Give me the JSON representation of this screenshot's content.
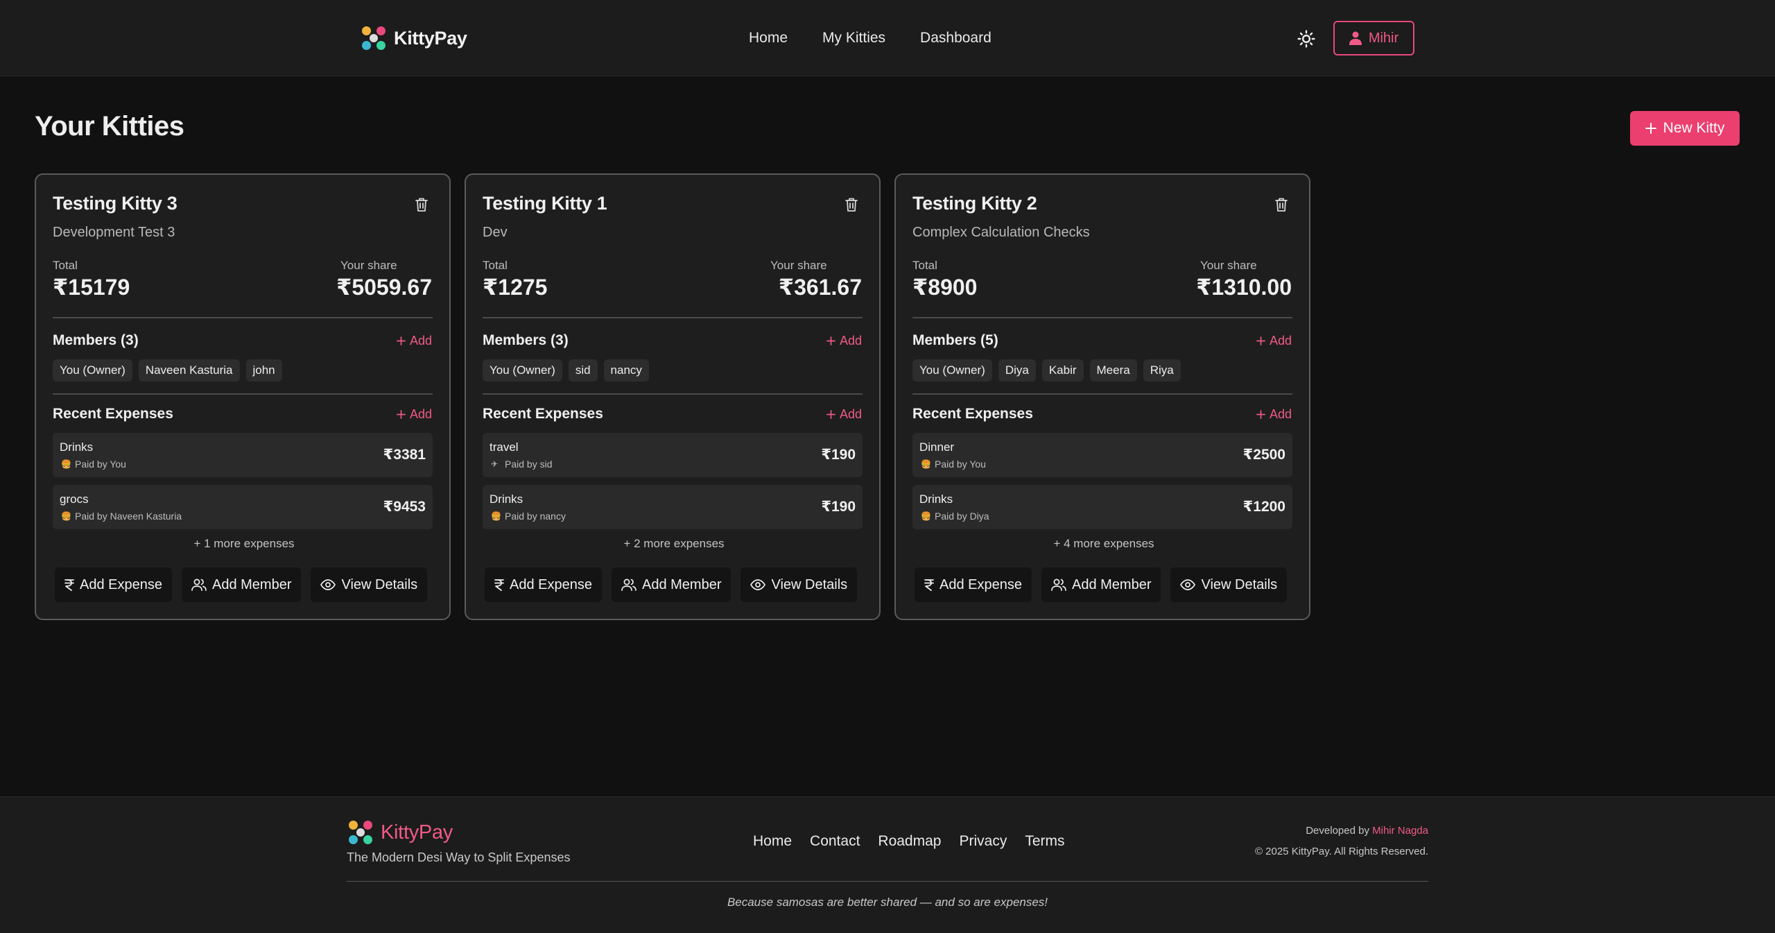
{
  "nav": {
    "brand": "KittyPay",
    "links": [
      "Home",
      "My Kitties",
      "Dashboard"
    ],
    "user_label": "Mihir"
  },
  "page": {
    "title": "Your Kitties",
    "new_kitty_label": "New Kitty"
  },
  "labels": {
    "total": "Total",
    "your_share": "Your share",
    "recent_expenses": "Recent Expenses",
    "add": "Add",
    "add_expense": "Add Expense",
    "add_member": "Add Member",
    "view_details": "View Details"
  },
  "kitties": [
    {
      "name": "Testing Kitty 3",
      "description": "Development Test 3",
      "total": "₹15179",
      "share": "₹5059.67",
      "members_title": "Members (3)",
      "members": [
        "You (Owner)",
        "Naveen Kasturia",
        "john"
      ],
      "expenses": [
        {
          "name": "Drinks",
          "paid_by": "Paid by You",
          "amount": "₹3381",
          "icon": "burger-icon"
        },
        {
          "name": "grocs",
          "paid_by": "Paid by Naveen Kasturia",
          "amount": "₹9453",
          "icon": "burger-icon"
        }
      ],
      "more": "+ 1 more expenses"
    },
    {
      "name": "Testing Kitty 1",
      "description": "Dev",
      "total": "₹1275",
      "share": "₹361.67",
      "members_title": "Members (3)",
      "members": [
        "You (Owner)",
        "sid",
        "nancy"
      ],
      "expenses": [
        {
          "name": "travel",
          "paid_by": "Paid by sid",
          "amount": "₹190",
          "icon": "airplane-icon"
        },
        {
          "name": "Drinks",
          "paid_by": "Paid by nancy",
          "amount": "₹190",
          "icon": "burger-icon"
        }
      ],
      "more": "+ 2 more expenses"
    },
    {
      "name": "Testing Kitty 2",
      "description": "Complex Calculation Checks",
      "total": "₹8900",
      "share": "₹1310.00",
      "members_title": "Members (5)",
      "members": [
        "You (Owner)",
        "Diya",
        "Kabir",
        "Meera",
        "Riya"
      ],
      "expenses": [
        {
          "name": "Dinner",
          "paid_by": "Paid by You",
          "amount": "₹2500",
          "icon": "burger-icon"
        },
        {
          "name": "Drinks",
          "paid_by": "Paid by Diya",
          "amount": "₹1200",
          "icon": "burger-icon"
        }
      ],
      "more": "+ 4 more expenses"
    }
  ],
  "footer": {
    "brand": "KittyPay",
    "tagline": "The Modern Desi Way to Split Expenses",
    "links": [
      "Home",
      "Contact",
      "Roadmap",
      "Privacy",
      "Terms"
    ],
    "developed_by": "Developed by",
    "developer": "Mihir Nagda",
    "copyright": "© 2025 KittyPay. All Rights Reserved.",
    "quote": "Because samosas are better shared — and so are expenses!"
  },
  "colors": {
    "accent": "#ea3f6f",
    "background": "#111111",
    "card": "#1e1e1e"
  }
}
